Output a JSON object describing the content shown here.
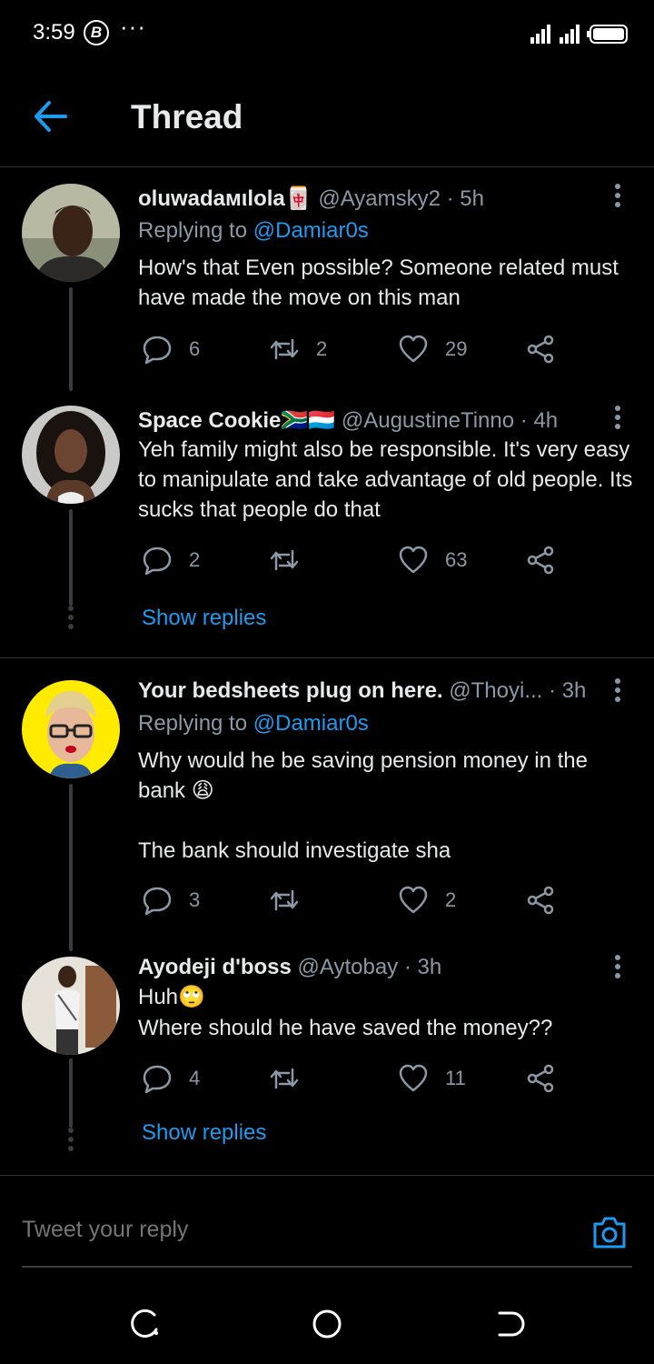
{
  "status_bar": {
    "time": "3:59",
    "badge": "B"
  },
  "header": {
    "title": "Thread"
  },
  "tweets": [
    {
      "name": "oluwadaмιlola🀄",
      "handle": "@Ayamsky2",
      "time": "· 5h",
      "reply_prefix": "Replying to ",
      "reply_to": "@Damiar0s",
      "text": "How's that Even possible? Someone related must have made the move on this man",
      "replies": "6",
      "retweets": "2",
      "likes": "29"
    },
    {
      "name": "Space Cookie🇿🇦🇱🇺",
      "handle": "@AugustineTinno",
      "time": "· 4h",
      "text": "Yeh family might also be responsible. It's very easy to manipulate and take advantage of old people. Its sucks that people do that",
      "replies": "2",
      "retweets": "",
      "likes": "63"
    },
    {
      "name": "Your bedsheets plug on here.",
      "handle": "@Thoyi...",
      "time": "· 3h",
      "reply_prefix": "Replying to ",
      "reply_to": "@Damiar0s",
      "text": "Why would he be saving pension money in the bank 😩",
      "text2": "The bank should investigate sha",
      "replies": "3",
      "retweets": "",
      "likes": "2"
    },
    {
      "name": "Ayodeji d'boss",
      "handle": "@Aytobay",
      "time": "· 3h",
      "text": "Huh🙄",
      "text2": "Where should he have saved the money??",
      "replies": "4",
      "retweets": "",
      "likes": "11"
    }
  ],
  "show_replies": "Show replies",
  "reply_bar": {
    "placeholder": "Tweet your reply"
  },
  "colors": {
    "accent": "#1d9bf0",
    "muted": "#8b98a5",
    "background": "#000000"
  }
}
